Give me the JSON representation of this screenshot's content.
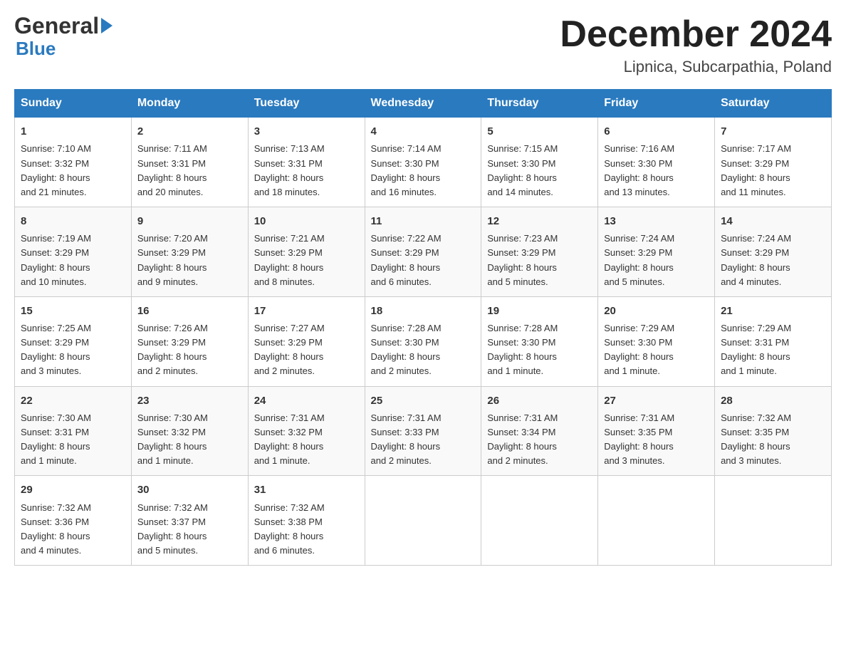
{
  "logo": {
    "part1": "General",
    "part2": "Blue"
  },
  "title": "December 2024",
  "subtitle": "Lipnica, Subcarpathia, Poland",
  "days_of_week": [
    "Sunday",
    "Monday",
    "Tuesday",
    "Wednesday",
    "Thursday",
    "Friday",
    "Saturday"
  ],
  "weeks": [
    [
      {
        "day": "1",
        "sunrise": "7:10 AM",
        "sunset": "3:32 PM",
        "daylight": "8 hours and 21 minutes."
      },
      {
        "day": "2",
        "sunrise": "7:11 AM",
        "sunset": "3:31 PM",
        "daylight": "8 hours and 20 minutes."
      },
      {
        "day": "3",
        "sunrise": "7:13 AM",
        "sunset": "3:31 PM",
        "daylight": "8 hours and 18 minutes."
      },
      {
        "day": "4",
        "sunrise": "7:14 AM",
        "sunset": "3:30 PM",
        "daylight": "8 hours and 16 minutes."
      },
      {
        "day": "5",
        "sunrise": "7:15 AM",
        "sunset": "3:30 PM",
        "daylight": "8 hours and 14 minutes."
      },
      {
        "day": "6",
        "sunrise": "7:16 AM",
        "sunset": "3:30 PM",
        "daylight": "8 hours and 13 minutes."
      },
      {
        "day": "7",
        "sunrise": "7:17 AM",
        "sunset": "3:29 PM",
        "daylight": "8 hours and 11 minutes."
      }
    ],
    [
      {
        "day": "8",
        "sunrise": "7:19 AM",
        "sunset": "3:29 PM",
        "daylight": "8 hours and 10 minutes."
      },
      {
        "day": "9",
        "sunrise": "7:20 AM",
        "sunset": "3:29 PM",
        "daylight": "8 hours and 9 minutes."
      },
      {
        "day": "10",
        "sunrise": "7:21 AM",
        "sunset": "3:29 PM",
        "daylight": "8 hours and 8 minutes."
      },
      {
        "day": "11",
        "sunrise": "7:22 AM",
        "sunset": "3:29 PM",
        "daylight": "8 hours and 6 minutes."
      },
      {
        "day": "12",
        "sunrise": "7:23 AM",
        "sunset": "3:29 PM",
        "daylight": "8 hours and 5 minutes."
      },
      {
        "day": "13",
        "sunrise": "7:24 AM",
        "sunset": "3:29 PM",
        "daylight": "8 hours and 5 minutes."
      },
      {
        "day": "14",
        "sunrise": "7:24 AM",
        "sunset": "3:29 PM",
        "daylight": "8 hours and 4 minutes."
      }
    ],
    [
      {
        "day": "15",
        "sunrise": "7:25 AM",
        "sunset": "3:29 PM",
        "daylight": "8 hours and 3 minutes."
      },
      {
        "day": "16",
        "sunrise": "7:26 AM",
        "sunset": "3:29 PM",
        "daylight": "8 hours and 2 minutes."
      },
      {
        "day": "17",
        "sunrise": "7:27 AM",
        "sunset": "3:29 PM",
        "daylight": "8 hours and 2 minutes."
      },
      {
        "day": "18",
        "sunrise": "7:28 AM",
        "sunset": "3:30 PM",
        "daylight": "8 hours and 2 minutes."
      },
      {
        "day": "19",
        "sunrise": "7:28 AM",
        "sunset": "3:30 PM",
        "daylight": "8 hours and 1 minute."
      },
      {
        "day": "20",
        "sunrise": "7:29 AM",
        "sunset": "3:30 PM",
        "daylight": "8 hours and 1 minute."
      },
      {
        "day": "21",
        "sunrise": "7:29 AM",
        "sunset": "3:31 PM",
        "daylight": "8 hours and 1 minute."
      }
    ],
    [
      {
        "day": "22",
        "sunrise": "7:30 AM",
        "sunset": "3:31 PM",
        "daylight": "8 hours and 1 minute."
      },
      {
        "day": "23",
        "sunrise": "7:30 AM",
        "sunset": "3:32 PM",
        "daylight": "8 hours and 1 minute."
      },
      {
        "day": "24",
        "sunrise": "7:31 AM",
        "sunset": "3:32 PM",
        "daylight": "8 hours and 1 minute."
      },
      {
        "day": "25",
        "sunrise": "7:31 AM",
        "sunset": "3:33 PM",
        "daylight": "8 hours and 2 minutes."
      },
      {
        "day": "26",
        "sunrise": "7:31 AM",
        "sunset": "3:34 PM",
        "daylight": "8 hours and 2 minutes."
      },
      {
        "day": "27",
        "sunrise": "7:31 AM",
        "sunset": "3:35 PM",
        "daylight": "8 hours and 3 minutes."
      },
      {
        "day": "28",
        "sunrise": "7:32 AM",
        "sunset": "3:35 PM",
        "daylight": "8 hours and 3 minutes."
      }
    ],
    [
      {
        "day": "29",
        "sunrise": "7:32 AM",
        "sunset": "3:36 PM",
        "daylight": "8 hours and 4 minutes."
      },
      {
        "day": "30",
        "sunrise": "7:32 AM",
        "sunset": "3:37 PM",
        "daylight": "8 hours and 5 minutes."
      },
      {
        "day": "31",
        "sunrise": "7:32 AM",
        "sunset": "3:38 PM",
        "daylight": "8 hours and 6 minutes."
      },
      null,
      null,
      null,
      null
    ]
  ],
  "labels": {
    "sunrise": "Sunrise:",
    "sunset": "Sunset:",
    "daylight": "Daylight:"
  }
}
